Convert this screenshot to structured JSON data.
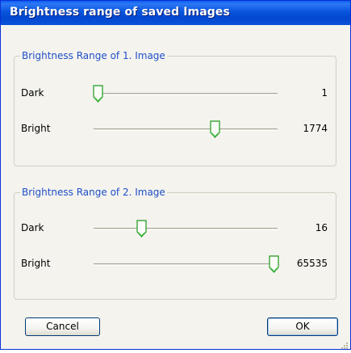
{
  "window": {
    "title": "Brightness range of saved Images"
  },
  "groups": [
    {
      "legend": "Brightness Range of 1. Image",
      "dark": {
        "label": "Dark",
        "value": "1",
        "position": 0.02
      },
      "bright": {
        "label": "Bright",
        "value": "1774",
        "position": 0.66
      }
    },
    {
      "legend": "Brightness Range of 2. Image",
      "dark": {
        "label": "Dark",
        "value": "16",
        "position": 0.26
      },
      "bright": {
        "label": "Bright",
        "value": "65535",
        "position": 0.98
      }
    }
  ],
  "buttons": {
    "cancel": "Cancel",
    "ok": "OK"
  },
  "colors": {
    "titlebar": "#0855dd",
    "legend_text": "#1f4fc8",
    "thumb_accent": "#21a121"
  },
  "icons": {
    "slider_thumb": "slider-thumb-icon",
    "resize_grip": "resize-grip-icon"
  }
}
